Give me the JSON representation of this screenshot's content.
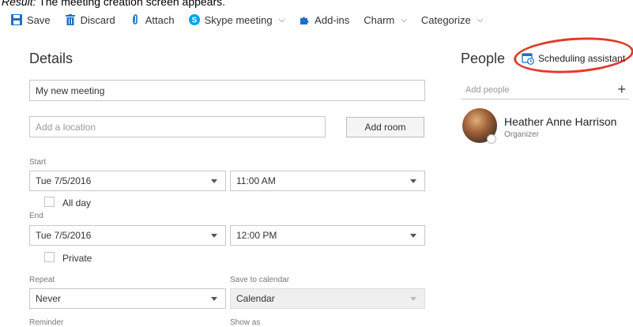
{
  "caption": {
    "lead": "Result:",
    "text": " The meeting creation screen appears."
  },
  "toolbar": {
    "save": "Save",
    "discard": "Discard",
    "attach": "Attach",
    "skype": "Skype meeting",
    "addins": "Add-ins",
    "charm": "Charm",
    "categorize": "Categorize"
  },
  "details": {
    "heading": "Details",
    "title_value": "My new meeting",
    "location_placeholder": "Add a location",
    "add_room": "Add room",
    "start_label": "Start",
    "start_date": "Tue 7/5/2016",
    "start_time": "11:00 AM",
    "all_day": "All day",
    "end_label": "End",
    "end_date": "Tue 7/5/2016",
    "end_time": "12:00 PM",
    "private": "Private",
    "repeat_label": "Repeat",
    "repeat_value": "Never",
    "save_to_calendar_label": "Save to calendar",
    "calendar_value": "Calendar",
    "reminder_label": "Reminder",
    "show_as_label": "Show as"
  },
  "people": {
    "heading": "People",
    "scheduling_assistant": "Scheduling assistant",
    "add_people_placeholder": "Add people",
    "person_name": "Heather Anne Harrison",
    "person_role": "Organizer"
  },
  "colors": {
    "accent": "#0f6cbd",
    "highlight_ring": "#e03a2a",
    "skype": "#00a2ed"
  }
}
